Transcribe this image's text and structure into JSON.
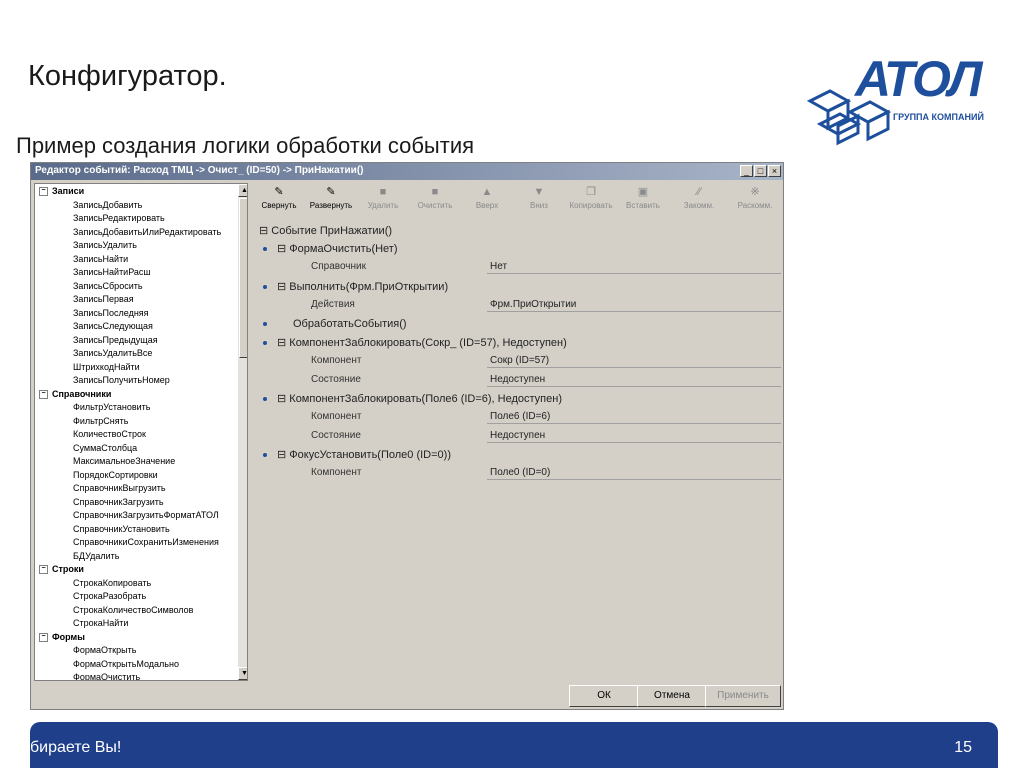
{
  "slide": {
    "title": "Конфигуратор.",
    "subtitle": "Пример создания логики обработки события",
    "logo_text": "АТОЛ",
    "logo_sub": "ГРУППА КОМПАНИЙ",
    "footer_text": "бираете Вы!",
    "page_number": "15",
    "brand_color": "#1e4f9c",
    "footer_color": "#1f3f8a"
  },
  "window": {
    "title": "Редактор событий: Расход ТМЦ -> Очист_ (ID=50) -> ПриНажатии()",
    "buttons": {
      "min": "_",
      "max": "□",
      "close": "×"
    }
  },
  "tree": {
    "groups": [
      {
        "label": "Записи",
        "items": [
          "ЗаписьДобавить",
          "ЗаписьРедактировать",
          "ЗаписьДобавитьИлиРедактировать",
          "ЗаписьУдалить",
          "ЗаписьНайти",
          "ЗаписьНайтиРасш",
          "ЗаписьСбросить",
          "ЗаписьПервая",
          "ЗаписьПоследняя",
          "ЗаписьСледующая",
          "ЗаписьПредыдущая",
          "ЗаписьУдалитьВсе",
          "ШтрихкодНайти",
          "ЗаписьПолучитьНомер"
        ]
      },
      {
        "label": "Справочники",
        "items": [
          "ФильтрУстановить",
          "ФильтрСнять",
          "КоличествоСтрок",
          "СуммаСтолбца",
          "МаксимальноеЗначение",
          "ПорядокСортировки",
          "СправочникВыгрузить",
          "СправочникЗагрузить",
          "СправочникЗагрузитьФорматАТОЛ",
          "СправочникУстановить",
          "СправочникиСохранитьИзменения",
          "БДУдалить"
        ]
      },
      {
        "label": "Строки",
        "items": [
          "СтрокаКопировать",
          "СтрокаРазобрать",
          "СтрокаКоличествоСимволов",
          "СтрокаНайти"
        ]
      },
      {
        "label": "Формы",
        "items": [
          "ФормаОткрыть",
          "ФормаОткрытьМодально",
          "ФормаОчистить"
        ]
      }
    ]
  },
  "toolbar": {
    "tools": [
      {
        "icon": "collapse-icon",
        "glyph": "✎",
        "label": "Свернуть",
        "enabled": true
      },
      {
        "icon": "expand-icon",
        "glyph": "✎",
        "label": "Развернуть",
        "enabled": true
      },
      {
        "icon": "delete-icon",
        "glyph": "■",
        "label": "Удалить",
        "enabled": false
      },
      {
        "icon": "clear-icon",
        "glyph": "■",
        "label": "Очистить",
        "enabled": false
      },
      {
        "icon": "up-icon",
        "glyph": "▲",
        "label": "Вверх",
        "enabled": false
      },
      {
        "icon": "down-icon",
        "glyph": "▼",
        "label": "Вниз",
        "enabled": false
      },
      {
        "icon": "copy-icon",
        "glyph": "❐",
        "label": "Копировать",
        "enabled": false
      },
      {
        "icon": "paste-icon",
        "glyph": "▣",
        "label": "Вставить",
        "enabled": false
      },
      {
        "icon": "comment-icon",
        "glyph": "∕∕",
        "label": "Закомм.",
        "enabled": false
      },
      {
        "icon": "uncomment-icon",
        "glyph": "※",
        "label": "Раскомм.",
        "enabled": false
      }
    ]
  },
  "events": {
    "root": "Событие ПриНажатии()",
    "actions": [
      {
        "label": "ФормаОчистить(Нет)",
        "expander": "⊟",
        "props": [
          {
            "name": "Справочник",
            "value": "Нет"
          }
        ]
      },
      {
        "label": "Выполнить(Фрм.ПриОткрытии)",
        "expander": "⊟",
        "props": [
          {
            "name": "Действия",
            "value": "Фрм.ПриОткрытии"
          }
        ]
      },
      {
        "label": "ОбработатьСобытия()",
        "expander": "",
        "props": []
      },
      {
        "label": "КомпонентЗаблокировать(Сокр_ (ID=57), Недоступен)",
        "expander": "⊟",
        "props": [
          {
            "name": "Компонент",
            "value": "Сокр (ID=57)"
          },
          {
            "name": "Состояние",
            "value": "Недоступен"
          }
        ]
      },
      {
        "label": "КомпонентЗаблокировать(Поле6 (ID=6), Недоступен)",
        "expander": "⊟",
        "props": [
          {
            "name": "Компонент",
            "value": "Поле6 (ID=6)"
          },
          {
            "name": "Состояние",
            "value": "Недоступен"
          }
        ]
      },
      {
        "label": "ФокусУстановить(Поле0 (ID=0))",
        "expander": "⊟",
        "props": [
          {
            "name": "Компонент",
            "value": "Поле0 (ID=0)"
          }
        ]
      }
    ]
  },
  "dialog_buttons": {
    "ok": "ОК",
    "cancel": "Отмена",
    "apply": "Применить"
  }
}
